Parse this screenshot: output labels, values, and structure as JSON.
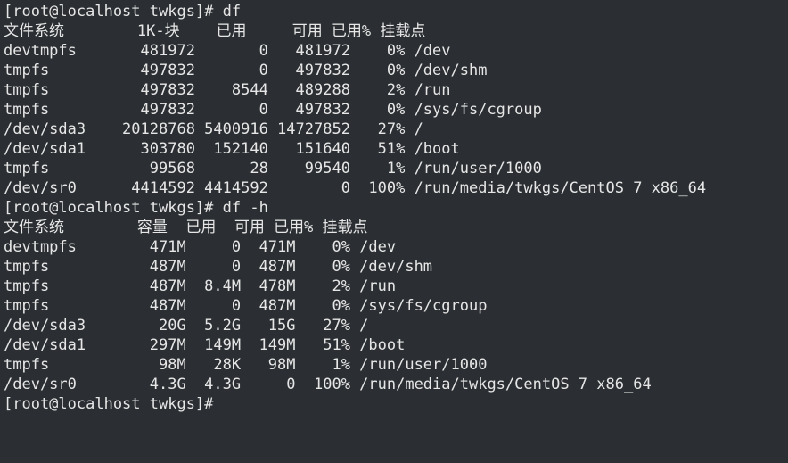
{
  "lines": [
    "[root@localhost twkgs]# df",
    "文件系统        1K-块    已用     可用 已用% 挂载点",
    "devtmpfs       481972       0   481972    0% /dev",
    "tmpfs          497832       0   497832    0% /dev/shm",
    "tmpfs          497832    8544   489288    2% /run",
    "tmpfs          497832       0   497832    0% /sys/fs/cgroup",
    "/dev/sda3    20128768 5400916 14727852   27% /",
    "/dev/sda1      303780  152140   151640   51% /boot",
    "tmpfs           99568      28    99540    1% /run/user/1000",
    "/dev/sr0      4414592 4414592        0  100% /run/media/twkgs/CentOS 7 x86_64",
    "[root@localhost twkgs]# df -h",
    "文件系统        容量  已用  可用 已用% 挂载点",
    "devtmpfs        471M     0  471M    0% /dev",
    "tmpfs           487M     0  487M    0% /dev/shm",
    "tmpfs           487M  8.4M  478M    2% /run",
    "tmpfs           487M     0  487M    0% /sys/fs/cgroup",
    "/dev/sda3        20G  5.2G   15G   27% /",
    "/dev/sda1       297M  149M  149M   51% /boot",
    "tmpfs            98M   28K   98M    1% /run/user/1000",
    "/dev/sr0        4.3G  4.3G     0  100% /run/media/twkgs/CentOS 7 x86_64",
    "[root@localhost twkgs]# "
  ]
}
